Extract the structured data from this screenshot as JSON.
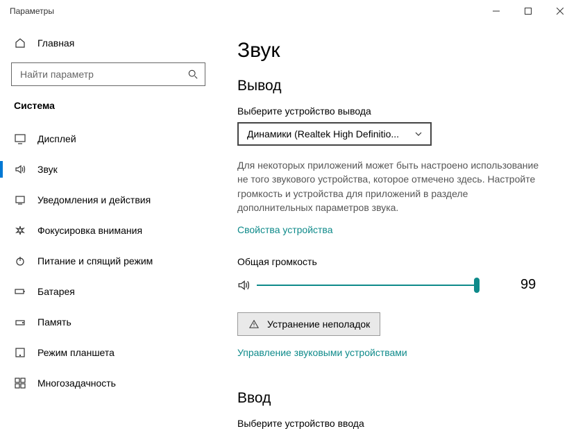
{
  "window": {
    "title": "Параметры"
  },
  "sidebar": {
    "home": "Главная",
    "search_placeholder": "Найти параметр",
    "category": "Система",
    "items": [
      {
        "label": "Дисплей"
      },
      {
        "label": "Звук"
      },
      {
        "label": "Уведомления и действия"
      },
      {
        "label": "Фокусировка внимания"
      },
      {
        "label": "Питание и спящий режим"
      },
      {
        "label": "Батарея"
      },
      {
        "label": "Память"
      },
      {
        "label": "Режим планшета"
      },
      {
        "label": "Многозадачность"
      }
    ]
  },
  "main": {
    "title": "Звук",
    "output_heading": "Вывод",
    "output_device_label": "Выберите устройство вывода",
    "output_device_selected": "Динамики (Realtek High Definitio...",
    "output_note": "Для некоторых приложений может быть настроено использование не того звукового устройства, которое отмечено здесь. Настройте громкость и устройства для приложений в разделе дополнительных параметров звука.",
    "device_properties": "Свойства устройства",
    "volume_label": "Общая громкость",
    "volume_value": "99",
    "troubleshoot": "Устранение неполадок",
    "manage_devices": "Управление звуковыми устройствами",
    "input_heading": "Ввод",
    "input_device_label": "Выберите устройство ввода"
  }
}
